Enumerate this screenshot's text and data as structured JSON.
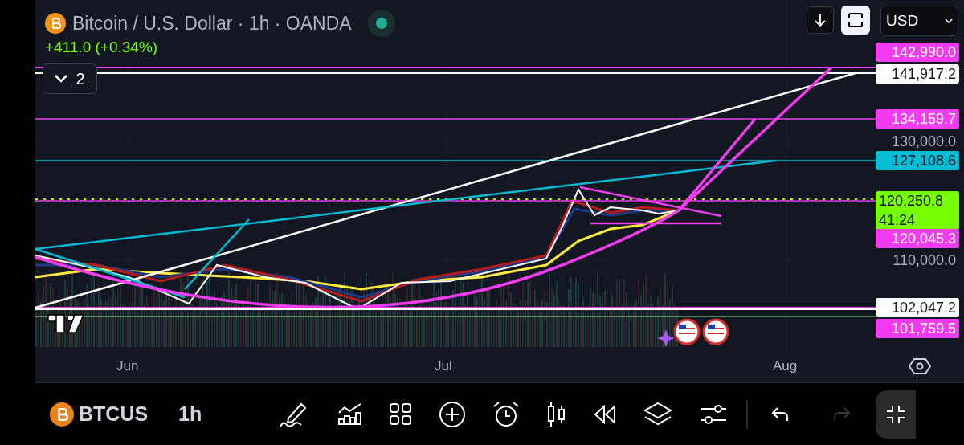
{
  "header": {
    "title": "Bitcoin / U.S. Dollar · 1h · OANDA",
    "change": "+411.0 (+0.34%)"
  },
  "legend_toggle": {
    "count": "2"
  },
  "currency": "USD",
  "price_labels": [
    {
      "kind": "marker",
      "text": "142,990.0",
      "color": "#f23cf0"
    },
    {
      "kind": "marker",
      "text": "141,917.2",
      "color": "#ffffff"
    },
    {
      "kind": "marker",
      "text": "134,159.7",
      "color": "#f23cf0"
    },
    {
      "kind": "tick",
      "text": "130,000.0"
    },
    {
      "kind": "marker",
      "text": "127,108.6",
      "color": "#00bcd4"
    },
    {
      "kind": "marker",
      "text": "120,250.8",
      "countdown": "41:24",
      "color": "#76ff03"
    },
    {
      "kind": "marker",
      "text": "120,045.3",
      "color": "#f23cf0"
    },
    {
      "kind": "tick",
      "text": "110,000.0"
    },
    {
      "kind": "marker",
      "text": "102,047.2",
      "color": "#ffffff"
    },
    {
      "kind": "marker",
      "text": "101,759.5",
      "color": "#f23cf0"
    }
  ],
  "time_axis": [
    "Jun",
    "Jul",
    "Aug"
  ],
  "toolbar": {
    "symbol": "BTCUS",
    "interval": "1h",
    "redo_disabled": true
  }
}
